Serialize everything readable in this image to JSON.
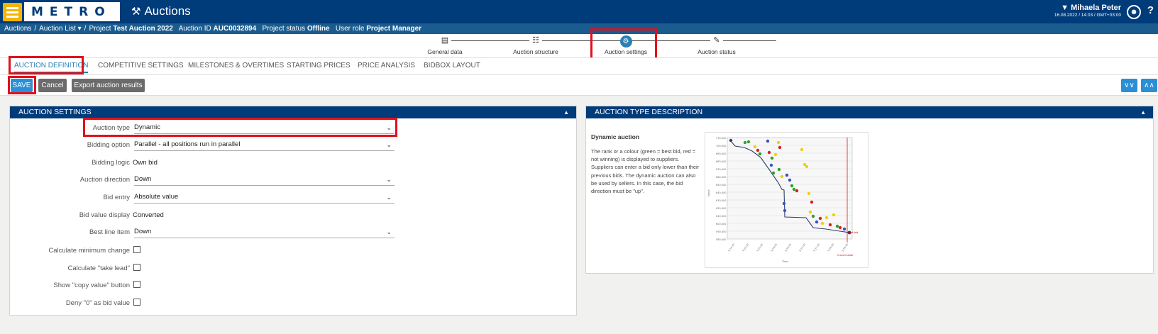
{
  "header": {
    "logo": "METRO",
    "app_title": "Auctions",
    "user_name": "Mihaela Peter",
    "user_meta": "16.08.2022 / 14:03 / GMT+03:00",
    "help": "?"
  },
  "breadcrumb": {
    "auctions": "Auctions",
    "auction_list": "Auction List",
    "project_label": "Project",
    "project_value": "Test Auction 2022",
    "auction_id_label": "Auction ID",
    "auction_id_value": "AUC0032894",
    "project_status_label": "Project status",
    "project_status_value": "Offline",
    "user_role_label": "User role",
    "user_role_value": "Project Manager"
  },
  "steps": [
    {
      "label": "General data",
      "icon": "database-icon"
    },
    {
      "label": "Auction structure",
      "icon": "hierarchy-icon"
    },
    {
      "label": "Auction settings",
      "icon": "gear-icon"
    },
    {
      "label": "Auction status",
      "icon": "edit-icon"
    }
  ],
  "tabs": [
    {
      "label": "AUCTION DEFINITION"
    },
    {
      "label": "COMPETITIVE SETTINGS"
    },
    {
      "label": "MILESTONES & OVERTIMES"
    },
    {
      "label": "STARTING PRICES"
    },
    {
      "label": "PRICE ANALYSIS"
    },
    {
      "label": "BIDBOX LAYOUT"
    }
  ],
  "toolbar": {
    "save": "SAVE",
    "cancel": "Cancel",
    "export": "Export auction results"
  },
  "settings_panel": {
    "title": "AUCTION SETTINGS",
    "rows": [
      {
        "label": "Auction type",
        "kind": "select",
        "value": "Dynamic"
      },
      {
        "label": "Bidding option",
        "kind": "select",
        "value": "Parallel - all positions run in parallel"
      },
      {
        "label": "Bidding logic",
        "kind": "text",
        "value": "Own bid"
      },
      {
        "label": "Auction direction",
        "kind": "select",
        "value": "Down"
      },
      {
        "label": "Bid entry",
        "kind": "select",
        "value": "Absolute value"
      },
      {
        "label": "Bid value display",
        "kind": "text",
        "value": "Converted"
      },
      {
        "label": "Best line item",
        "kind": "select",
        "value": "Down"
      },
      {
        "label": "Calculate minimum change",
        "kind": "checkbox",
        "value": false
      },
      {
        "label": "Calculate \"take lead\"",
        "kind": "checkbox",
        "value": false
      },
      {
        "label": "Show \"copy value\" button",
        "kind": "checkbox",
        "value": false
      },
      {
        "label": "Deny \"0\" as bid value",
        "kind": "checkbox",
        "value": false
      }
    ]
  },
  "description_panel": {
    "title": "AUCTION TYPE DESCRIPTION",
    "heading": "Dynamic auction",
    "text": "The rank or a colour (green = best bid, red = not winning) is displayed to suppliers. Suppliers can enter a bid only lower than their previous bids. The dynamic auction can also be used by sellers. In this case, the bid direction must be \"up\"."
  },
  "colors": {
    "brand_blue": "#003b7a",
    "accent_yellow": "#f4b400",
    "button_blue": "#2b8fd6",
    "highlight_red": "#e0111b"
  }
}
